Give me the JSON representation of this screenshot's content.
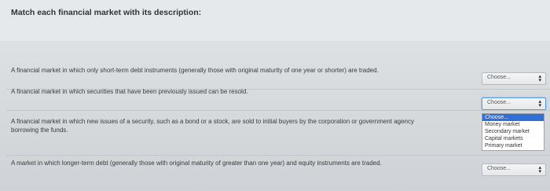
{
  "question": {
    "title": "Match each financial market with its description:"
  },
  "rows": [
    {
      "description": "A financial market in which only short-term debt instruments (generally those with original maturity of one year or shorter) are traded.",
      "selected": "Choose..."
    },
    {
      "description": "A financial market in which securities that have been previously issued can be resold.",
      "selected": "Choose..."
    },
    {
      "description_line1": "A financial market in which new issues of a security, such as a bond or a stock, are sold to initial buyers by the corporation or government agency",
      "description_line2": "borrowing the funds.",
      "selected": "Choose..."
    },
    {
      "description": "A market in which longer-term debt (generally those with original maturity of greater than one year) and equity instruments are traded.",
      "selected": "Choose..."
    }
  ],
  "dropdown": {
    "options": [
      "Choose...",
      "Money market",
      "Secondary market",
      "Capital markets",
      "Primary market"
    ]
  },
  "icons": {
    "select_arrows": "up-down-arrows-icon",
    "dropdown_caret": "caret-right-icon"
  }
}
